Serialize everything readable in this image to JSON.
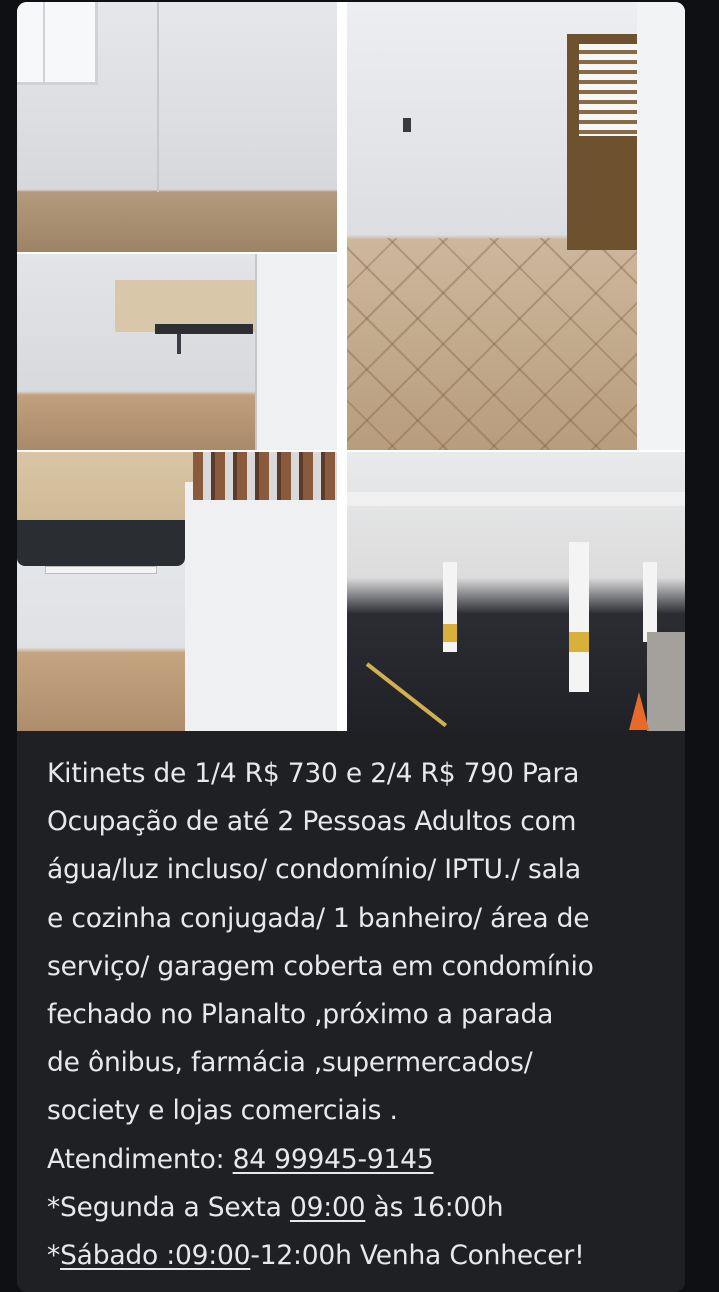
{
  "message": {
    "photos": [
      {
        "name": "room-corner-photo"
      },
      {
        "name": "kitchen-niche-photo"
      },
      {
        "name": "room-with-door-photo"
      },
      {
        "name": "laundry-sink-photo"
      },
      {
        "name": "covered-garage-photo"
      }
    ],
    "text_lines": [
      "Kitinets de 1/4 R$ 730 e 2/4 R$ 790 Para",
      "Ocupação de até 2 Pessoas Adultos com",
      "água/luz incluso/ condomínio/ IPTU./ sala",
      "e cozinha conjugada/ 1 banheiro/ área de",
      "serviço/ garagem coberta em condomínio",
      "fechado no Planalto ,próximo a parada",
      "de ônibus, farmácia ,supermercados/",
      "society e lojas comerciais ."
    ],
    "contact_label": "Atendimento: ",
    "phone": "84 99945-9145",
    "hours_weekday_prefix": "*Segunda a Sexta ",
    "hours_weekday_start": "09:00",
    "hours_weekday_suffix": " às 16:00h",
    "hours_saturday_prefix": "*",
    "hours_saturday_link": "Sábado :09:00",
    "hours_saturday_suffix": "-12:00h Venha Conhecer!"
  }
}
